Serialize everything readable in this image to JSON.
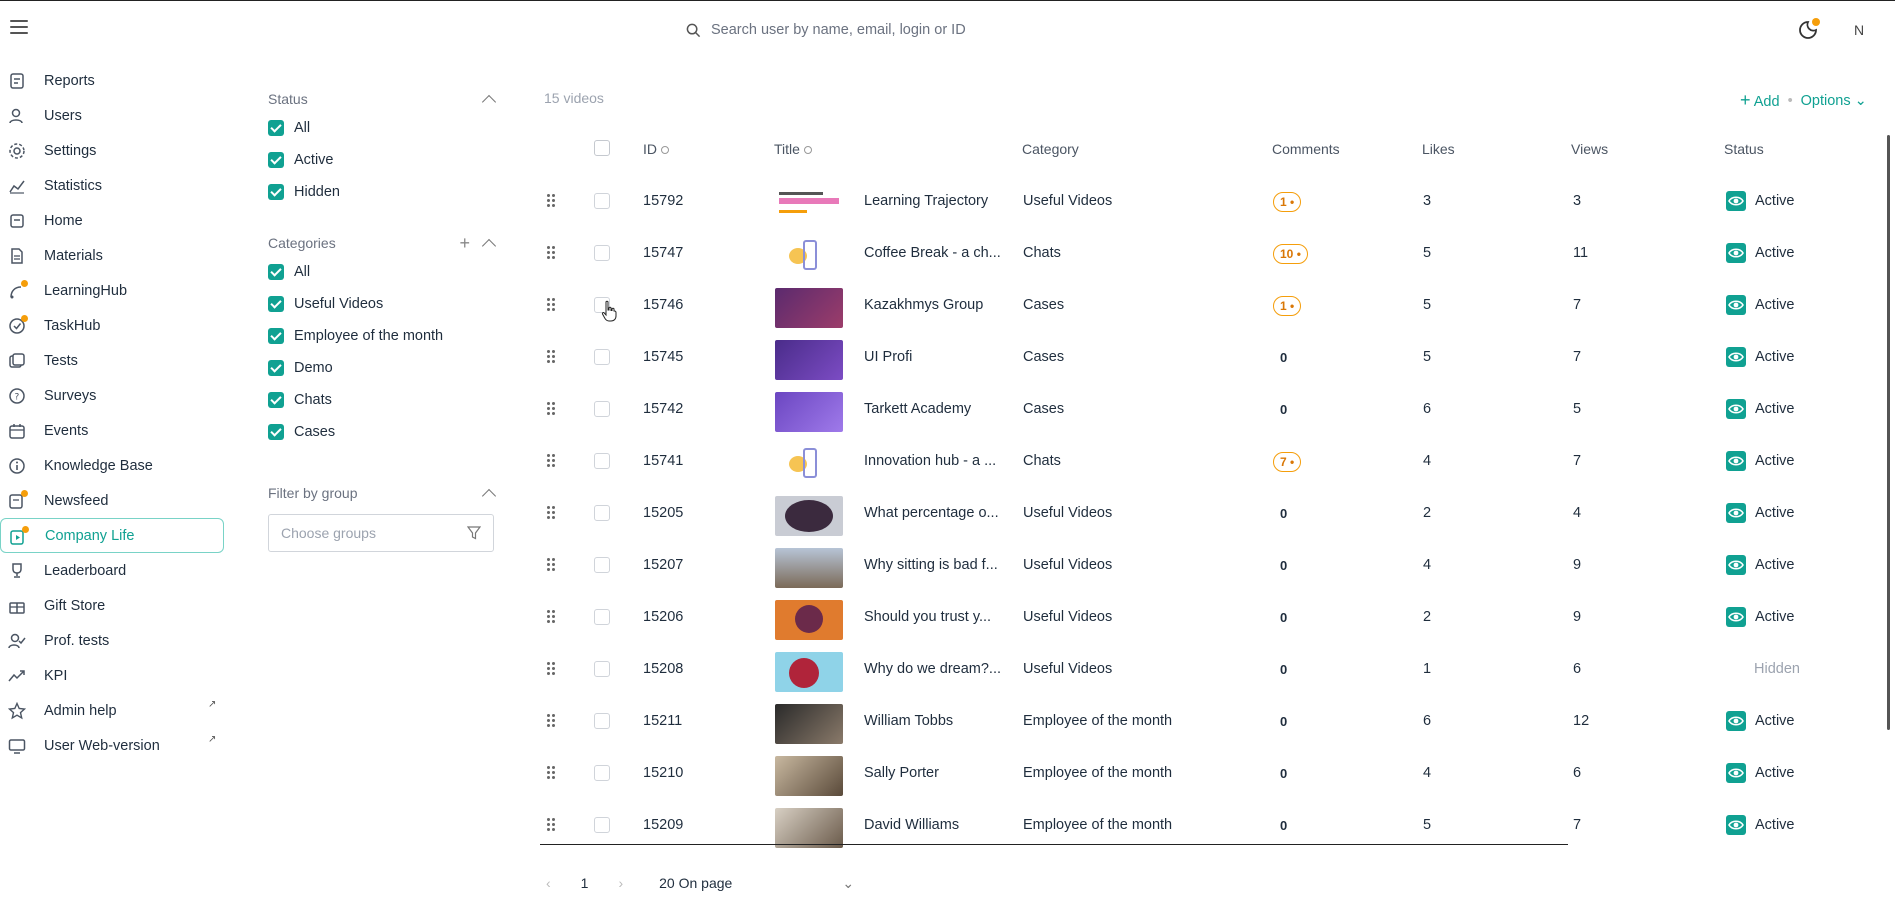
{
  "header": {
    "search_placeholder": "Search user by name, email, login or ID",
    "avatar_initial": "N"
  },
  "sidebar": {
    "items": [
      {
        "label": "Reports",
        "icon": "report-icon"
      },
      {
        "label": "Users",
        "icon": "users-icon"
      },
      {
        "label": "Settings",
        "icon": "gear-icon"
      },
      {
        "label": "Statistics",
        "icon": "chart-line-icon"
      },
      {
        "label": "Home",
        "icon": "home-icon"
      },
      {
        "label": "Materials",
        "icon": "document-icon"
      },
      {
        "label": "LearningHub",
        "icon": "learning-icon"
      },
      {
        "label": "TaskHub",
        "icon": "task-icon"
      },
      {
        "label": "Tests",
        "icon": "tests-icon"
      },
      {
        "label": "Surveys",
        "icon": "survey-icon"
      },
      {
        "label": "Events",
        "icon": "calendar-icon"
      },
      {
        "label": "Knowledge Base",
        "icon": "info-icon"
      },
      {
        "label": "Newsfeed",
        "icon": "newsfeed-icon"
      },
      {
        "label": "Company Life",
        "icon": "video-icon",
        "active": true
      },
      {
        "label": "Leaderboard",
        "icon": "trophy-icon"
      },
      {
        "label": "Gift Store",
        "icon": "gift-icon"
      },
      {
        "label": "Prof. tests",
        "icon": "user-check-icon"
      },
      {
        "label": "KPI",
        "icon": "trend-icon"
      },
      {
        "label": "Admin help",
        "icon": "star-icon",
        "external": true
      },
      {
        "label": "User Web-version",
        "icon": "monitor-icon",
        "external": true
      }
    ]
  },
  "filters": {
    "status": {
      "title": "Status",
      "options": [
        "All",
        "Active",
        "Hidden"
      ]
    },
    "categories": {
      "title": "Categories",
      "options": [
        "All",
        "Useful Videos",
        "Employee of the month",
        "Demo",
        "Chats",
        "Cases"
      ]
    },
    "group": {
      "title": "Filter by group",
      "placeholder": "Choose groups"
    }
  },
  "main": {
    "count_label": "15 videos",
    "add_label": "Add",
    "options_label": "Options",
    "columns": {
      "id": "ID",
      "title": "Title",
      "category": "Category",
      "comments": "Comments",
      "likes": "Likes",
      "views": "Views",
      "status": "Status"
    },
    "rows": [
      {
        "id": "15792",
        "title": "Learning Trajectory",
        "category": "Useful Videos",
        "comments": "1",
        "likes": "3",
        "views": "3",
        "status": "Active",
        "thumb": "learning"
      },
      {
        "id": "15747",
        "title": "Coffee Break - a ch...",
        "category": "Chats",
        "comments": "10",
        "likes": "5",
        "views": "11",
        "status": "Active",
        "thumb": "chat"
      },
      {
        "id": "15746",
        "title": "Kazakhmys Group",
        "category": "Cases",
        "comments": "1",
        "likes": "5",
        "views": "7",
        "status": "Active",
        "thumb": "purple"
      },
      {
        "id": "15745",
        "title": "UI Profi",
        "category": "Cases",
        "comments": "0",
        "likes": "5",
        "views": "7",
        "status": "Active",
        "thumb": "purple2"
      },
      {
        "id": "15742",
        "title": "Tarkett Academy",
        "category": "Cases",
        "comments": "0",
        "likes": "6",
        "views": "5",
        "status": "Active",
        "thumb": "purple3"
      },
      {
        "id": "15741",
        "title": "Innovation hub - a ...",
        "category": "Chats",
        "comments": "7",
        "likes": "4",
        "views": "7",
        "status": "Active",
        "thumb": "chat"
      },
      {
        "id": "15205",
        "title": "What percentage o...",
        "category": "Useful Videos",
        "comments": "0",
        "likes": "2",
        "views": "4",
        "status": "Active",
        "thumb": "brain"
      },
      {
        "id": "15207",
        "title": "Why sitting is bad f...",
        "category": "Useful Videos",
        "comments": "0",
        "likes": "4",
        "views": "9",
        "status": "Active",
        "thumb": "office"
      },
      {
        "id": "15206",
        "title": "Should you trust y...",
        "category": "Useful Videos",
        "comments": "0",
        "likes": "2",
        "views": "9",
        "status": "Active",
        "thumb": "orange"
      },
      {
        "id": "15208",
        "title": "Why do we dream?...",
        "category": "Useful Videos",
        "comments": "0",
        "likes": "1",
        "views": "6",
        "status": "Hidden",
        "thumb": "dream"
      },
      {
        "id": "15211",
        "title": "William Tobbs",
        "category": "Employee of the month",
        "comments": "0",
        "likes": "6",
        "views": "12",
        "status": "Active",
        "thumb": "person1"
      },
      {
        "id": "15210",
        "title": "Sally Porter",
        "category": "Employee of the month",
        "comments": "0",
        "likes": "4",
        "views": "6",
        "status": "Active",
        "thumb": "person2"
      },
      {
        "id": "15209",
        "title": "David Williams",
        "category": "Employee of the month",
        "comments": "0",
        "likes": "5",
        "views": "7",
        "status": "Active",
        "thumb": "person3"
      }
    ]
  },
  "pager": {
    "page": "1",
    "page_size_label": "20 On page"
  },
  "colors": {
    "accent": "#10a192",
    "badge": "#f59e0b",
    "text": "#1f2d3d"
  }
}
